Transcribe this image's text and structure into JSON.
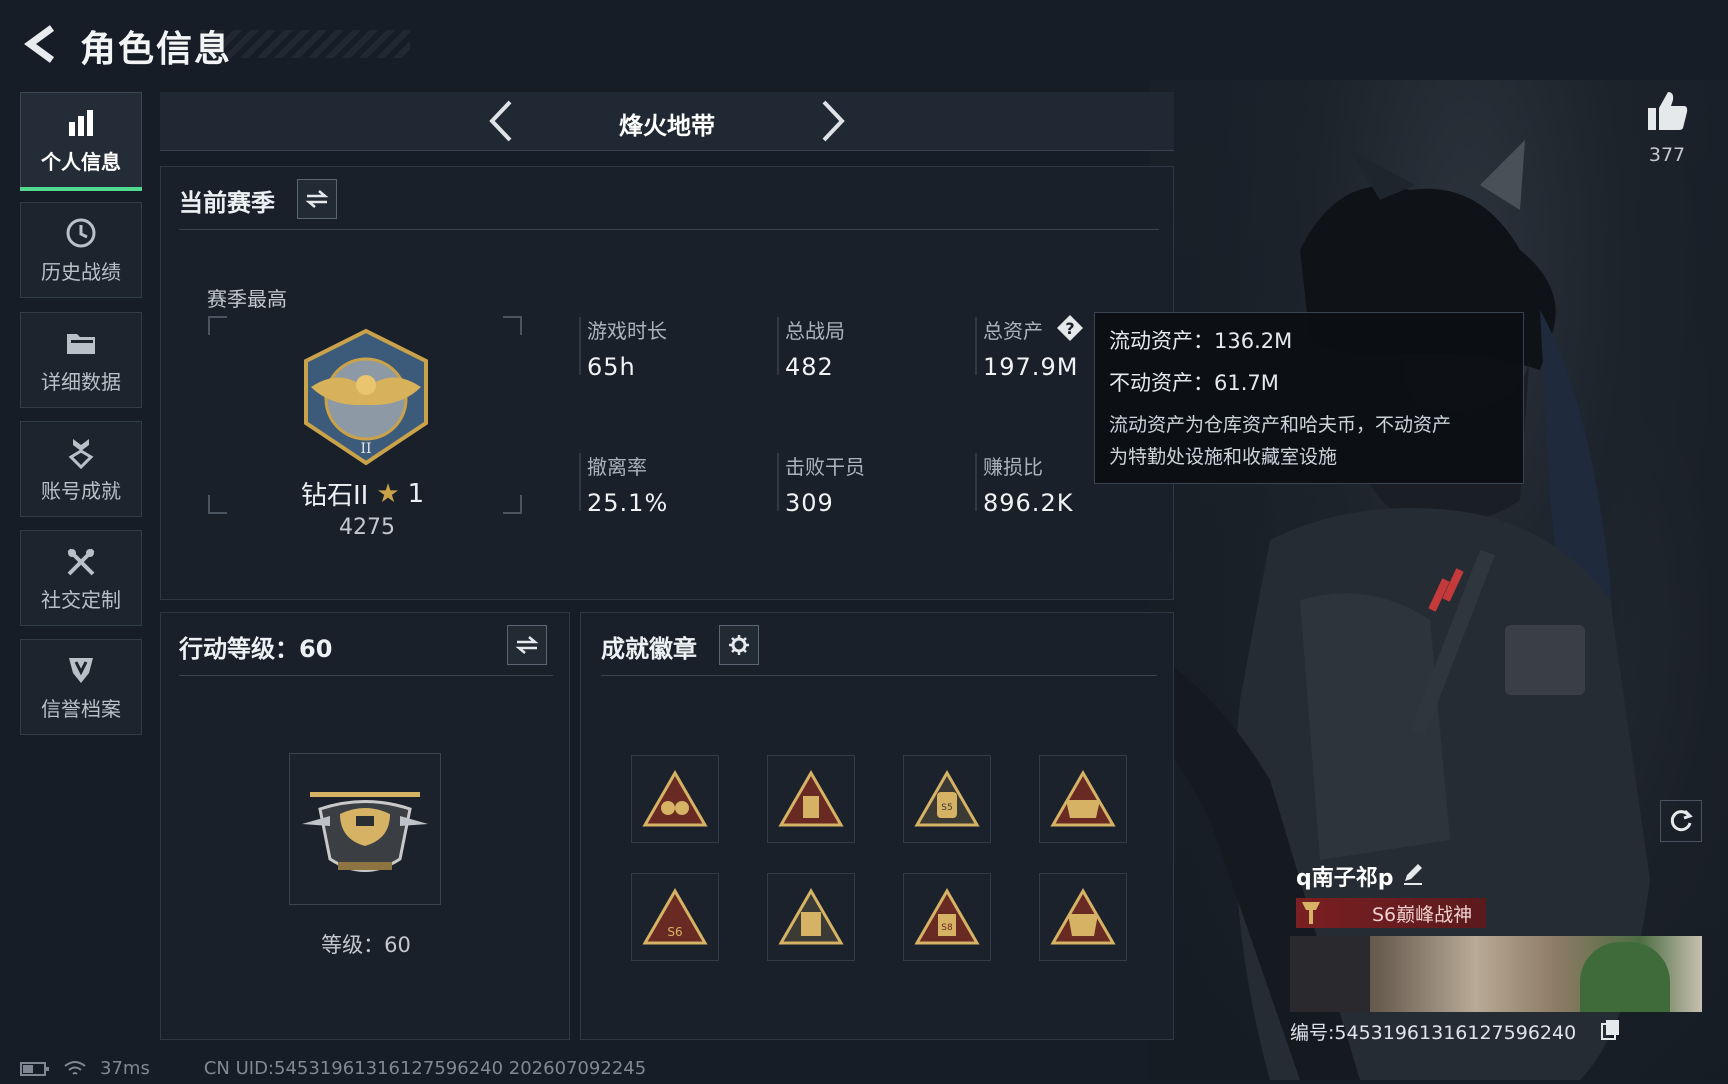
{
  "header": {
    "title": "角色信息"
  },
  "sidebar": {
    "items": [
      {
        "label": "个人信息",
        "icon": "bar-chart-icon",
        "active": true
      },
      {
        "label": "历史战绩",
        "icon": "clock-icon",
        "active": false
      },
      {
        "label": "详细数据",
        "icon": "folder-icon",
        "active": false
      },
      {
        "label": "账号成就",
        "icon": "medal-icon",
        "active": false
      },
      {
        "label": "社交定制",
        "icon": "tools-icon",
        "active": false
      },
      {
        "label": "信誉档案",
        "icon": "shield-icon",
        "active": false
      }
    ]
  },
  "season_nav": {
    "mode": "烽火地带"
  },
  "current_season": {
    "title": "当前赛季",
    "best_label": "赛季最高",
    "rank_name": "钻石II",
    "rank_stars": "1",
    "rank_score": "4275",
    "stats": [
      {
        "label": "游戏时长",
        "value": "65h"
      },
      {
        "label": "总战局",
        "value": "482"
      },
      {
        "label": "总资产",
        "value": "197.9M"
      },
      {
        "label": "撤离率",
        "value": "25.1%"
      },
      {
        "label": "击败干员",
        "value": "309"
      },
      {
        "label": "赚损比",
        "value": "896.2K"
      }
    ]
  },
  "tooltip": {
    "liquid": "流动资产：136.2M",
    "fixed": "不动资产：61.7M",
    "note_line1": "流动资产为仓库资产和哈夫币，不动资产",
    "note_line2": "为特勤处设施和收藏室设施"
  },
  "action_level": {
    "title": "行动等级：60",
    "level_text": "等级：60"
  },
  "achievements": {
    "title": "成就徽章",
    "badges": [
      "badge-1",
      "badge-2",
      "badge-3",
      "badge-4",
      "badge-5",
      "badge-6",
      "badge-7",
      "badge-8"
    ]
  },
  "likes": {
    "count": "377"
  },
  "profile": {
    "name": "q南子祁p",
    "title_badge": "S6巅峰战神",
    "id_text": "编号:545319613161275962​40"
  },
  "status_bar": {
    "ping": "37ms",
    "uid": "CN UID:545319613161275962​40  202607092245"
  },
  "colors": {
    "accent_green": "#53d88f",
    "gold": "#c9a24a",
    "title_red": "#7a1f22"
  }
}
